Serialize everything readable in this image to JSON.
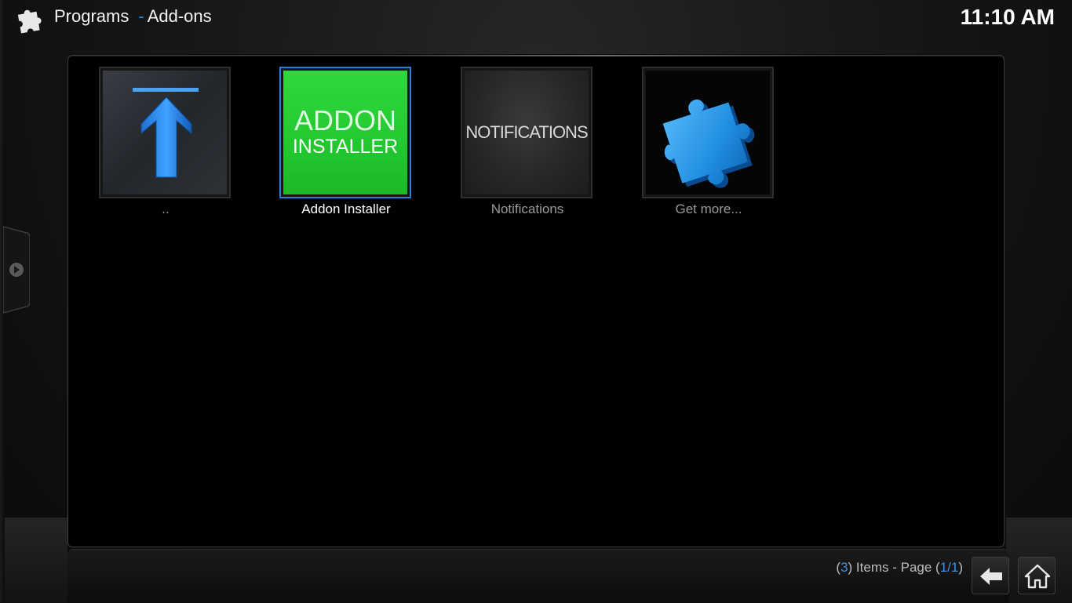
{
  "header": {
    "title": "Programs",
    "separator": "-",
    "subtitle": "Add-ons",
    "icon": "puzzle-icon",
    "clock": "11:10 AM"
  },
  "items": [
    {
      "label": "..",
      "icon": "parent-folder-up-arrow-icon",
      "selected": false
    },
    {
      "label": "Addon Installer",
      "thumb_line1": "ADDON",
      "thumb_line2": "INSTALLER",
      "selected": true
    },
    {
      "label": "Notifications",
      "thumb_text": "NOTIFICATIONS",
      "selected": false
    },
    {
      "label": "Get more...",
      "icon": "puzzle-piece-icon",
      "selected": false
    }
  ],
  "footer": {
    "paren_open": "(",
    "count": "3",
    "items_text": ") Items - Page (",
    "page": "1/1",
    "paren_close": ")"
  },
  "colors": {
    "accent": "#2a7fd8",
    "addon_green": "#26cc33"
  }
}
